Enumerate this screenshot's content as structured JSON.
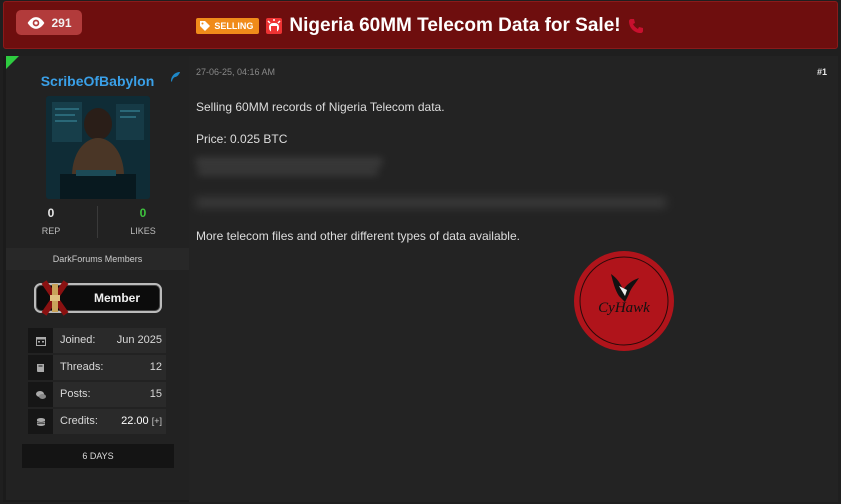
{
  "header": {
    "views": "291",
    "tag": "SELLING",
    "title": "Nigeria 60MM Telecom Data for Sale!"
  },
  "sidebar": {
    "username": "ScribeOfBabylon",
    "stats": {
      "rep": {
        "value": "0",
        "label": "REP"
      },
      "likes": {
        "value": "0",
        "label": "LIKES"
      }
    },
    "group": "DarkForums Members",
    "badge": "Member",
    "info": [
      {
        "icon": "calendar-icon",
        "key": "Joined:",
        "value": "Jun 2025"
      },
      {
        "icon": "book-icon",
        "key": "Threads:",
        "value": "12"
      },
      {
        "icon": "comments-icon",
        "key": "Posts:",
        "value": "15"
      },
      {
        "icon": "coins-icon",
        "key": "Credits:",
        "value": "22.00",
        "extra": "[+]"
      }
    ],
    "days": "6 DAYS"
  },
  "post": {
    "date": "27-06-25, 04:16 AM",
    "number": "#1",
    "line1": "Selling 60MM records of Nigeria Telecom data.",
    "line2": "Price: 0.025 BTC",
    "line3": "More telecom files and other different types of data available.",
    "watermark": "CyHawk"
  },
  "colors": {
    "header_bg": "#6e0e0e",
    "tag_bg": "#f08b1a",
    "username": "#3aa0e8",
    "likes": "#3ec33e",
    "watermark": "#b0141b"
  }
}
